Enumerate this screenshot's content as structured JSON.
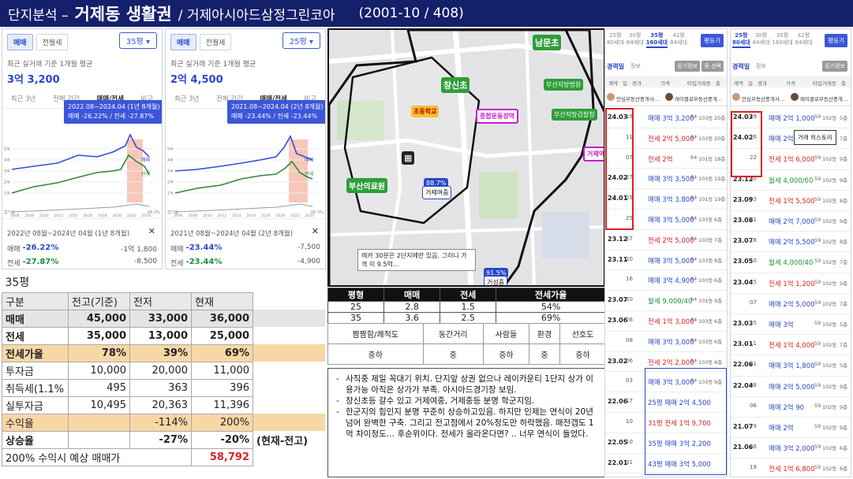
{
  "header": {
    "prefix": "단지분석 –",
    "title": "거제동 생활권",
    "subtitle": "/ 거제아시아드삼정그린코아",
    "info": "(2001-10 / 408)"
  },
  "chart_panels": [
    {
      "tab_active": "매매",
      "tab_other": "전월세",
      "size": "35평",
      "caption": "최근 실거래 기준 1개월 평균",
      "price": "3억 3,200",
      "periods": [
        "최근 3년",
        "전체 기간",
        "매매/전세",
        "비교"
      ],
      "badge_line1": "2022.08~2024.04 (1년 8개월)",
      "badge_line2": "매매 -26.22% / 전세 -27.87%",
      "yticks": [
        "5억",
        "4억",
        "3억",
        "2억",
        "1억"
      ],
      "xticks": [
        "2006",
        "2008",
        "2010",
        "2012",
        "2014",
        "2016",
        "2018",
        "2020",
        "2022",
        "2024"
      ],
      "legend_sale": "매매",
      "legend_jeonse": "전세",
      "legend_gap": "갭가율",
      "gap_value": "68.3%",
      "range": "2022년 08월~2024년 04월 (1년 8개월)",
      "close": "✕",
      "sale_label": "매매",
      "sale_pct": "-26.22%",
      "sale_amt": "-1억 1,800",
      "jeonse_label": "전세",
      "jeonse_pct": "-27.87%",
      "jeonse_amt": "-8,500"
    },
    {
      "tab_active": "매매",
      "tab_other": "전월세",
      "size": "25평",
      "caption": "최근 실거래 기준 1개월 평균",
      "price": "2억 4,500",
      "periods": [
        "최근 3년",
        "전체 기간",
        "매매/전세",
        "비교"
      ],
      "badge_line1": "2021.08~2024.04 (2년 8개월)",
      "badge_line2": "매매 -23.44% / 전세 -23.44%",
      "yticks": [
        "5억",
        "4억",
        "3억",
        "2억",
        "1억"
      ],
      "xticks": [
        "2006",
        "2008",
        "2010",
        "2012",
        "2014",
        "2016",
        "2018",
        "2020",
        "2022",
        "2024"
      ],
      "legend_sale": "매매",
      "legend_jeonse": "전세",
      "legend_gap": "갭가율",
      "gap_value": "68.3%",
      "range": "2021년 08월~2024년 04월 (2년 8개월)",
      "close": "✕",
      "sale_label": "매매",
      "sale_pct": "-23.44%",
      "sale_amt": "-7,500",
      "jeonse_label": "전세",
      "jeonse_pct": "-23.44%",
      "jeonse_amt": "-4,900"
    }
  ],
  "map": {
    "labels": [
      "남문초",
      "창신초",
      "초등학교",
      "종합운동장역",
      "부산지방법원",
      "부산지방검찰청",
      "거제역",
      "부산의료원",
      "88.7%",
      "거제여중",
      "91.5%",
      "거성중"
    ],
    "tooltip": "레카 30분은 2단지에만 있음. 그러니 가격 이 9.5억..."
  },
  "size_table": {
    "headers": [
      "평형",
      "매매",
      "전세",
      "전세가율"
    ],
    "rows": [
      [
        "25",
        "2.8",
        "1.5",
        "54%"
      ],
      [
        "35",
        "3.6",
        "2.5",
        "69%"
      ]
    ]
  },
  "rating_table": {
    "headers": [
      "짬짬함/쾌적도",
      "동간거리",
      "사람들",
      "환경",
      "선호도"
    ],
    "values": [
      "중하",
      "중",
      "중하",
      "중",
      "중하"
    ]
  },
  "notes": [
    "사직중 제일 꼭대기 위치. 단지앞 상권 없으나 레이카운티 1단지 상가 이용가능 아직은 상가가 부족. 아시아드경기장 보임.",
    "창신초등 갈수 있고 거제여중, 거제중등 분명 학군지임.",
    "한군지의 힘인지 분명 꾸준히 상승하고있음. 하지만 인제는 연식이 20년 넘어 완벽한 구축. 그리고 전고점에서 20%정도만 하락했음. 매전갭도 1억 차이정도… 후순위이다. 전세가 올라온다면? .. 너무 연식이 들었다."
  ],
  "calc_table": {
    "title": "35평",
    "headers": [
      "구분",
      "전고(기준)",
      "전저",
      "현재"
    ],
    "rows": [
      {
        "label": "매매",
        "v": [
          "45,000",
          "33,000",
          "36,000"
        ],
        "cls": "gray",
        "bold": true
      },
      {
        "label": "전세",
        "v": [
          "35,000",
          "13,000",
          "25,000"
        ],
        "cls": "",
        "bold": true
      },
      {
        "label": "전세가율",
        "v": [
          "78%",
          "39%",
          "69%"
        ],
        "cls": "hl",
        "bold": true
      },
      {
        "label": "투자금",
        "v": [
          "10,000",
          "20,000",
          "11,000"
        ],
        "cls": "",
        "bold": false
      },
      {
        "label": "취득세(1.1%",
        "v": [
          "495",
          "363",
          "396"
        ],
        "cls": "",
        "bold": false
      },
      {
        "label": "실투자금",
        "v": [
          "10,495",
          "20,363",
          "11,396"
        ],
        "cls": "",
        "bold": false
      },
      {
        "label": "수익율",
        "v": [
          "",
          "-114%",
          "200%"
        ],
        "cls": "hl",
        "bold": false
      },
      {
        "label": "상승율",
        "v": [
          "",
          "-27%",
          "-20%"
        ],
        "cls": "",
        "bold": true
      }
    ],
    "note": "(현재-전고)",
    "footer_label": "200% 수익시 예상 매매가",
    "footer_value": "58,792"
  },
  "tx_panels": [
    {
      "sizes": [
        [
          "25평",
          "80세대"
        ],
        [
          "30평",
          "84세대"
        ],
        [
          "35평",
          "160세대"
        ],
        [
          "42평",
          "84세대"
        ]
      ],
      "active_size": 2,
      "btn": "평등기",
      "sub": "경력일",
      "sub2": "정보",
      "btn2": "등기정보",
      "btn3": "동 선택",
      "cols": [
        "계약",
        "일",
        "경과",
        "가격",
        "타입",
        "거래동",
        "층"
      ],
      "agent1": "안심부동산중개사…",
      "agent2": "레이클로부동산중개…",
      "rows": [
        [
          "24.03",
          "19",
          "매매 3억 3,200",
          "84",
          "103동",
          "20층"
        ],
        [
          "",
          "11",
          "전세 2억 5,000",
          "84",
          "103동",
          "20층"
        ],
        [
          "",
          "07",
          "전세 2억",
          "84",
          "101동",
          "18층"
        ],
        [
          "24.02",
          "27",
          "매매 3억 3,500",
          "84",
          "103동",
          "19층"
        ],
        [
          "24.01",
          "29",
          "매매 3억 3,800",
          "84",
          "101동",
          "19층"
        ],
        [
          "",
          "25",
          "매매 3억 5,000",
          "84",
          "103동",
          "6층"
        ],
        [
          "23.12",
          "27",
          "전세 2억 5,000",
          "84",
          "103동",
          "7층"
        ],
        [
          "23.11",
          "20",
          "매매 3억 5,000",
          "84",
          "103동",
          "8층"
        ],
        [
          "",
          "16",
          "매매 3억 4,900",
          "84",
          "103동",
          "6층"
        ],
        [
          "23.07",
          "20",
          "월세 9,000/40",
          "84",
          "101동",
          "9층"
        ],
        [
          "23.06",
          "26",
          "전세 1억 3,000",
          "84",
          "103동",
          "6층"
        ],
        [
          "",
          "08",
          "매매 3억 3,000",
          "84",
          "103동",
          "6층"
        ],
        [
          "23.02",
          "06",
          "전세 2억 2,000",
          "84",
          "103동",
          "8층"
        ],
        [
          "",
          "03",
          "매매 3억 3,000",
          "84",
          "103동",
          "9층"
        ],
        [
          "22.06",
          "17",
          "25평 매매 2억 4,500",
          "",
          "",
          ""
        ],
        [
          "",
          "10",
          "31평 전세 1억 9,700",
          "",
          "",
          ""
        ],
        [
          "22.05",
          "10",
          "35평 매매 3억 2,200",
          "",
          "",
          ""
        ],
        [
          "22.01",
          "31",
          "43평 매매 3억 5,000",
          "",
          "",
          ""
        ]
      ]
    },
    {
      "sizes": [
        [
          "25평",
          "80세대"
        ],
        [
          "30평",
          "84세대"
        ],
        [
          "35평",
          "160세대"
        ],
        [
          "42평",
          "84세대"
        ]
      ],
      "active_size": 0,
      "btn": "평등기",
      "sub": "경력일",
      "sub2": "정보",
      "btn2": "등기정보",
      "btn3": "",
      "cols": [
        "계약",
        "일",
        "경과",
        "가격",
        "타입",
        "거래동",
        "층"
      ],
      "agent1": "안심부동산중개사…",
      "agent2": "레이클로부동산중개…",
      "tooltip": "거래 히스토리",
      "rows": [
        [
          "24.03",
          "29",
          "매매 2억 1,000",
          "59",
          "102동",
          "5층"
        ],
        [
          "24.02",
          "26",
          "매매 2억 4,500",
          "59",
          "102동",
          "7층"
        ],
        [
          "",
          "22",
          "전세 1억 6,000",
          "59",
          "102동",
          "9층"
        ],
        [
          "23.12",
          "30",
          "월세 4,000/60",
          "59",
          "102동",
          "9층"
        ],
        [
          "23.09",
          "03",
          "전세 1억 5,500",
          "59",
          "102동",
          "8층"
        ],
        [
          "23.08",
          "31",
          "매매 2억 7,000",
          "59",
          "102동",
          "9층"
        ],
        [
          "23.07",
          "18",
          "매매 2억 5,500",
          "59",
          "102동",
          "8층"
        ],
        [
          "23.05",
          "10",
          "월세 4,000/40",
          "59",
          "102동",
          "7층"
        ],
        [
          "23.04",
          "25",
          "전세 1억 1,200",
          "59",
          "102동",
          "9층"
        ],
        [
          "",
          "07",
          "매매 2억 5,000",
          "59",
          "102동",
          "7층"
        ],
        [
          "23.03",
          "15",
          "매매 3억",
          "59",
          "102동",
          "5층"
        ],
        [
          "23.01",
          "11",
          "전세 1억 4,000",
          "59",
          "102동",
          "7층"
        ],
        [
          "22.06",
          "21",
          "매매 3억 1,800",
          "59",
          "102동",
          "5층"
        ],
        [
          "22.04",
          "08",
          "매매 2억 5,000",
          "59",
          "102동",
          "9층"
        ],
        [
          "",
          "06",
          "매매 2억 90",
          "59",
          "102동",
          "9층"
        ],
        [
          "21.07",
          "29",
          "매매 2억",
          "59",
          "102동",
          "9층"
        ],
        [
          "21.06",
          "26",
          "매매 3억 2,000",
          "59",
          "102동",
          "6층"
        ],
        [
          "",
          "19",
          "전세 1억 6,800",
          "59",
          "102동",
          "8층"
        ]
      ]
    }
  ]
}
